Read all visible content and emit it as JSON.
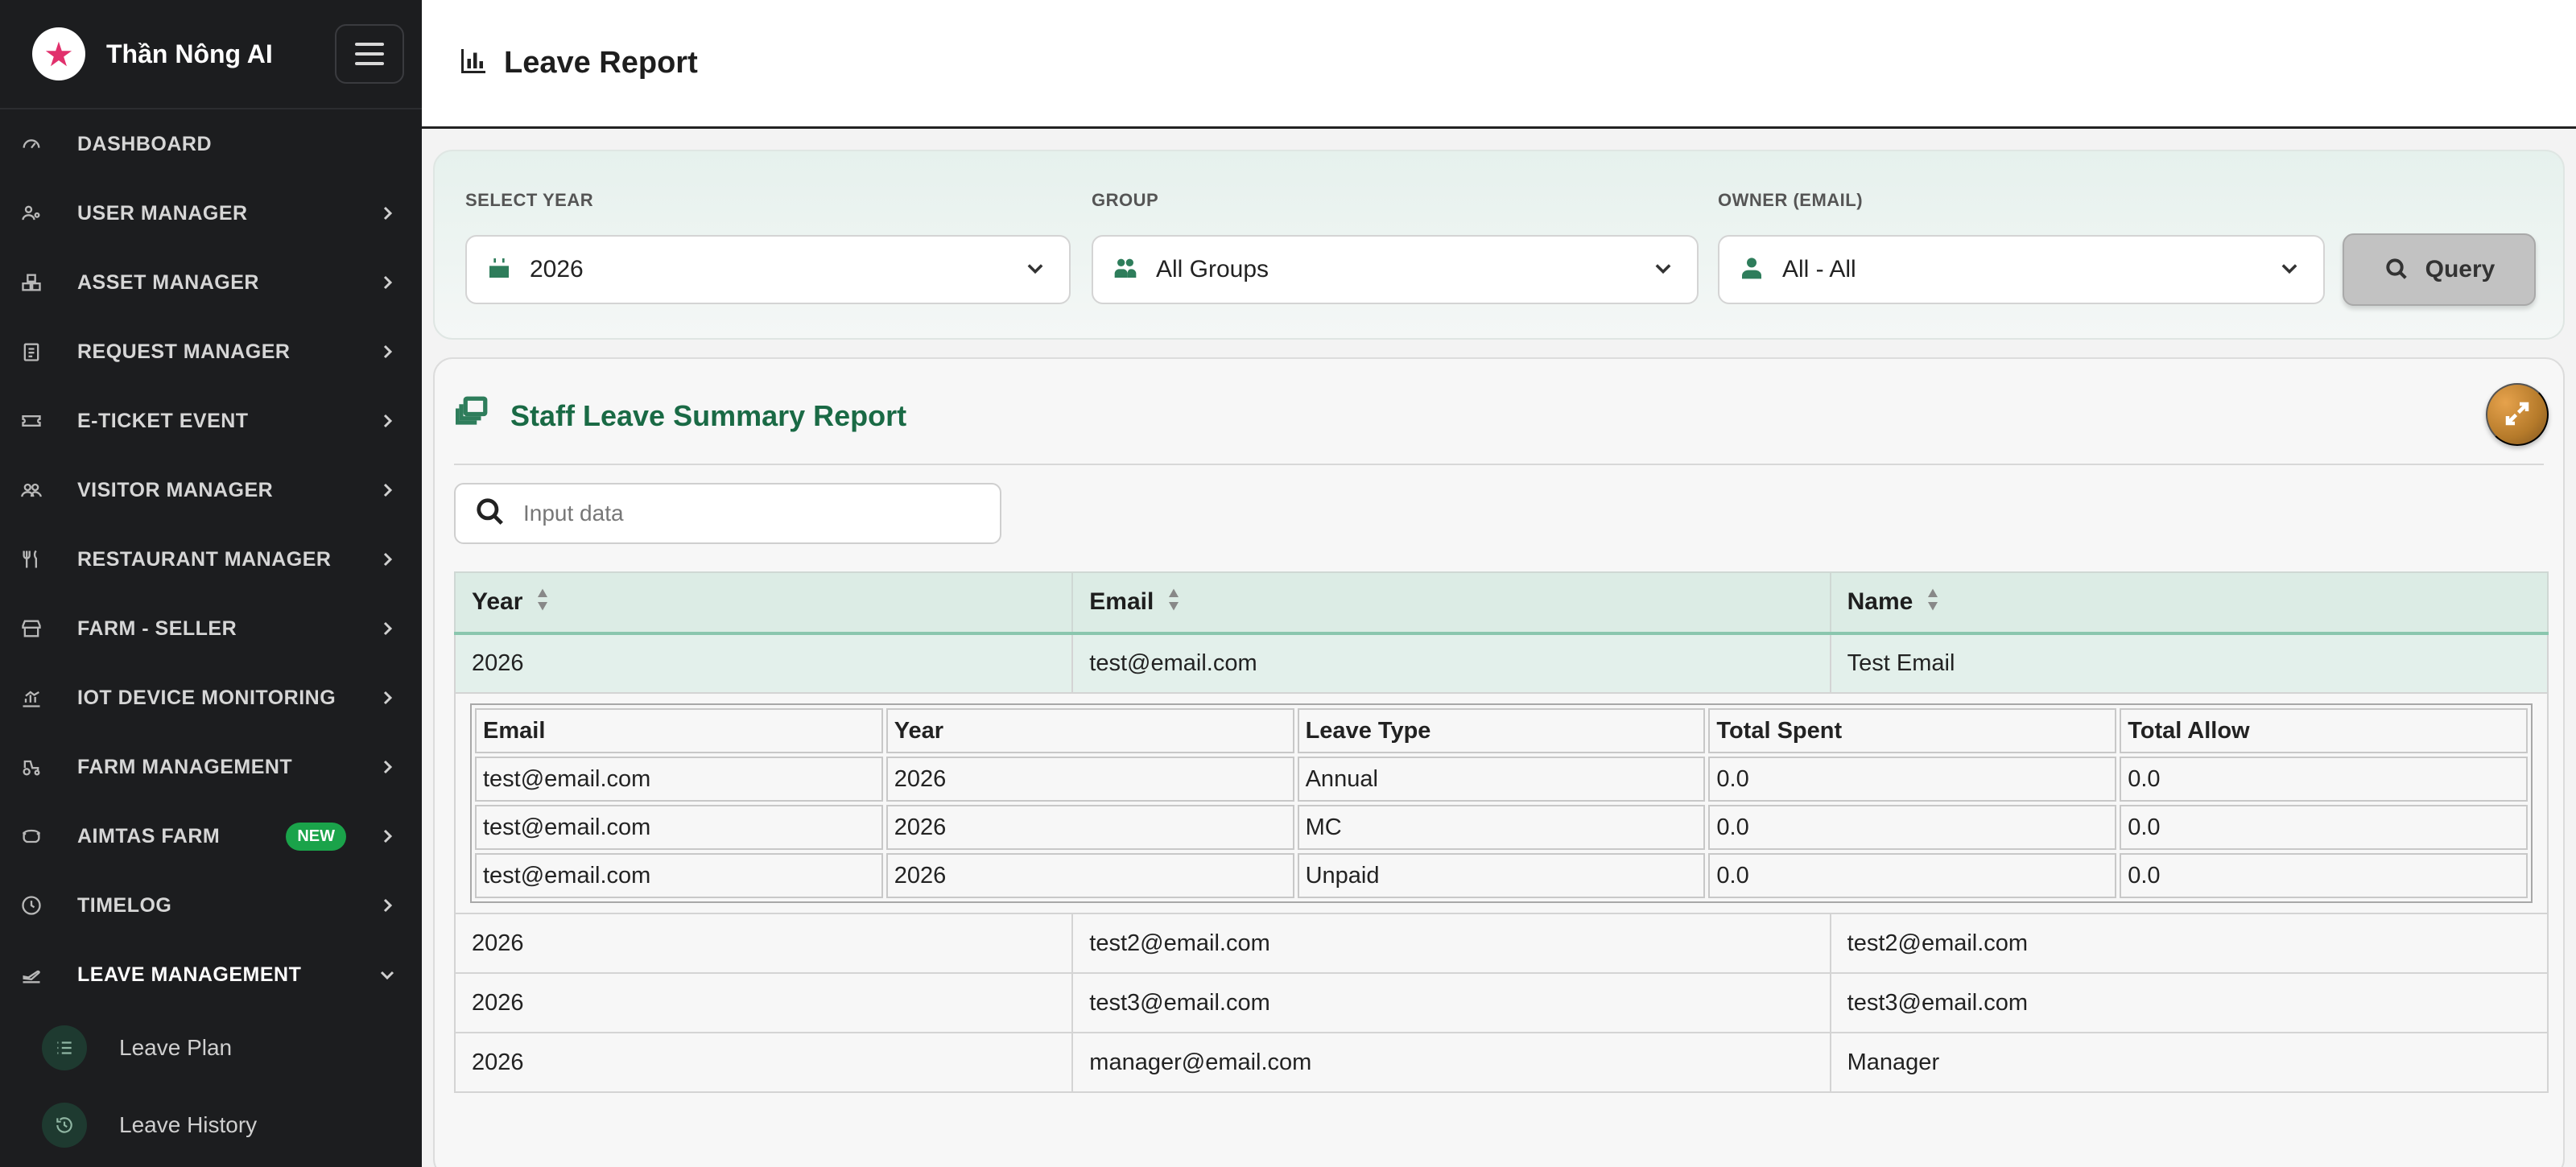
{
  "brand": {
    "name": "Thần Nông AI"
  },
  "sidebar": {
    "items": [
      {
        "label": "DASHBOARD",
        "icon": "gauge-icon"
      },
      {
        "label": "USER MANAGER",
        "icon": "users-cog-icon"
      },
      {
        "label": "ASSET MANAGER",
        "icon": "boxes-icon"
      },
      {
        "label": "REQUEST MANAGER",
        "icon": "clipboard-icon"
      },
      {
        "label": "E-TICKET EVENT",
        "icon": "ticket-icon"
      },
      {
        "label": "VISITOR MANAGER",
        "icon": "people-icon"
      },
      {
        "label": "RESTAURANT MANAGER",
        "icon": "utensils-icon"
      },
      {
        "label": "FARM - SELLER",
        "icon": "store-icon"
      },
      {
        "label": "IOT DEVICE MONITORING",
        "icon": "chart-icon"
      },
      {
        "label": "FARM MANAGEMENT",
        "icon": "tractor-icon"
      },
      {
        "label": "AIMTAS FARM",
        "icon": "cow-icon",
        "badge": "NEW"
      },
      {
        "label": "TIMELOG",
        "icon": "clock-icon"
      },
      {
        "label": "LEAVE MANAGEMENT",
        "icon": "plane-departure-icon"
      }
    ],
    "subitems": [
      {
        "label": "Leave Plan",
        "icon": "list-icon"
      },
      {
        "label": "Leave History",
        "icon": "history-icon"
      }
    ]
  },
  "header": {
    "title": "Leave Report"
  },
  "filters": {
    "year_label": "SELECT YEAR",
    "year_value": "2026",
    "group_label": "GROUP",
    "group_value": "All Groups",
    "owner_label": "OWNER (EMAIL)",
    "owner_value": "All - All",
    "query_label": "Query"
  },
  "report": {
    "title": "Staff Leave Summary Report",
    "search_placeholder": "Input data",
    "columns": [
      "Year",
      "Email",
      "Name"
    ],
    "rows": [
      {
        "year": "2026",
        "email": "test@email.com",
        "name": "Test Email"
      },
      {
        "year": "2026",
        "email": "test2@email.com",
        "name": "test2@email.com"
      },
      {
        "year": "2026",
        "email": "test3@email.com",
        "name": "test3@email.com"
      },
      {
        "year": "2026",
        "email": "manager@email.com",
        "name": "Manager"
      }
    ],
    "detail": {
      "columns": [
        "Email",
        "Year",
        "Leave Type",
        "Total Spent",
        "Total Allow"
      ],
      "rows": [
        {
          "email": "test@email.com",
          "year": "2026",
          "type": "Annual",
          "spent": "0.0",
          "allow": "0.0"
        },
        {
          "email": "test@email.com",
          "year": "2026",
          "type": "MC",
          "spent": "0.0",
          "allow": "0.0"
        },
        {
          "email": "test@email.com",
          "year": "2026",
          "type": "Unpaid",
          "spent": "0.0",
          "allow": "0.0"
        }
      ]
    }
  }
}
